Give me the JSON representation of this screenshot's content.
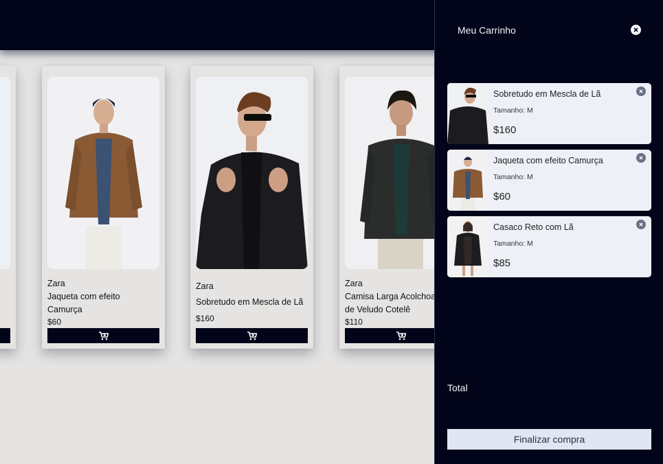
{
  "products": [
    {
      "brand": "Zara",
      "name": "Jaqueta com efeito\nCamurça",
      "price": "$60",
      "cart_icon": "add-to-cart-icon"
    },
    {
      "brand": "Zara",
      "name": "Sobretudo em Mescla de Lã",
      "price": "$160",
      "cart_icon": "add-to-cart-icon"
    },
    {
      "brand": "Zara",
      "name": "Camisa Larga Acolchoa\nde Veludo Cotelê",
      "price": "$110",
      "cart_icon": "add-to-cart-icon"
    }
  ],
  "cart": {
    "title": "Meu Carrinho",
    "close_icon": "close-icon",
    "items": [
      {
        "name": "Sobretudo em Mescla de Lã",
        "size": "Tamanho: M",
        "price": "$160"
      },
      {
        "name": "Jaqueta com efeito Camurça",
        "size": "Tamanho: M",
        "price": "$60"
      },
      {
        "name": "Casaco Reto com Lã",
        "size": "Tamanho: M",
        "price": "$85"
      }
    ],
    "total_label": "Total",
    "checkout_label": "Finalizar compra"
  },
  "colors": {
    "navy": "#02051a",
    "page_bg": "#e5e4e3",
    "cart_item_bg": "#eef0f7",
    "checkout_bg": "#e1e7f2"
  }
}
